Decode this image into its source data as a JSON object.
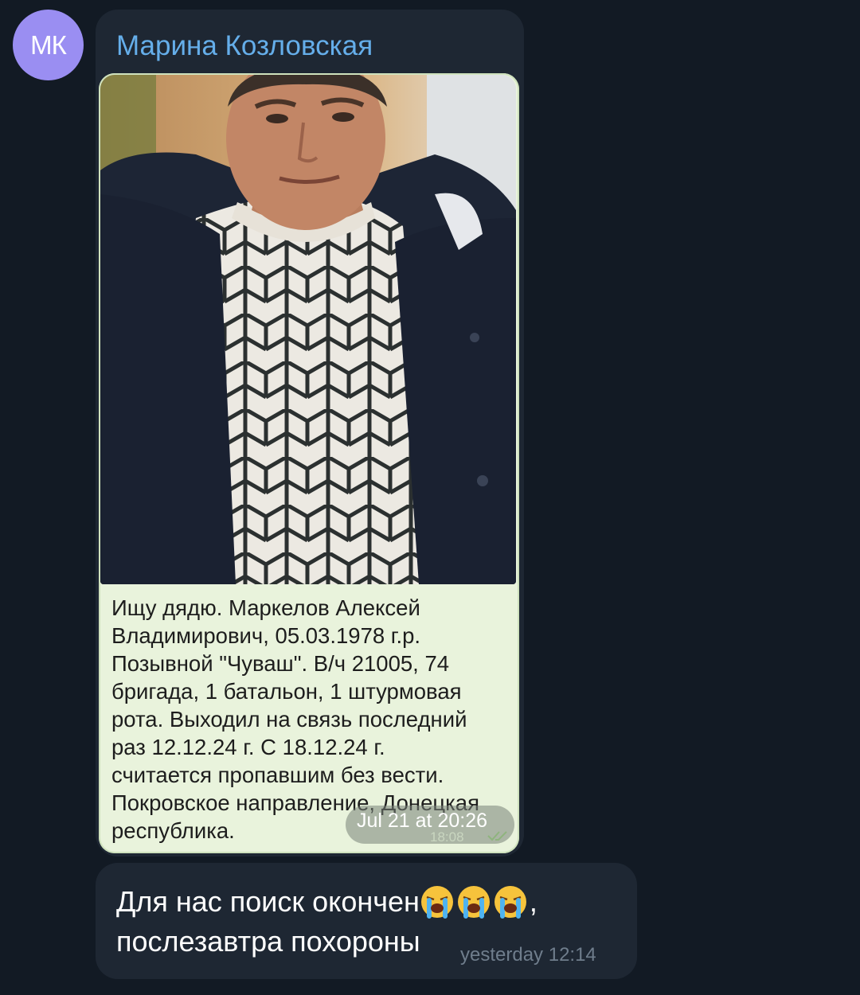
{
  "avatar": {
    "initials": "МК",
    "color": "#9a8ef2"
  },
  "message1": {
    "sender": "Марина Козловская",
    "caption": "Ищу дядю. Маркелов Алексей\nВладимирович, 05.03.1978 г.р.\nПозывной \"Чуваш\". В/ч 21005, 74\nбригада, 1 батальон, 1 штурмовая\nрота. Выходил на связь последний\nраз 12.12.24 г. С 18.12.24 г.\nсчитается пропавшим без вести.\nПокровское направление, Донецкая\nреспублика.",
    "date_pill": "Jul 21 at 20:26",
    "inner_time": "18:08",
    "status_icon": "double-check-icon"
  },
  "message2": {
    "text_line1": "Для нас поиск окончен",
    "emojis": [
      "loudly-crying-face-icon",
      "loudly-crying-face-icon",
      "loudly-crying-face-icon"
    ],
    "text_comma": ",",
    "text_line2": "послезавтра похороны",
    "time": "yesterday 12:14"
  },
  "colors": {
    "background": "#121a24",
    "bubble": "#1e2733",
    "sender_name": "#65aeea",
    "forwarded_card": "#e9f3dc"
  }
}
